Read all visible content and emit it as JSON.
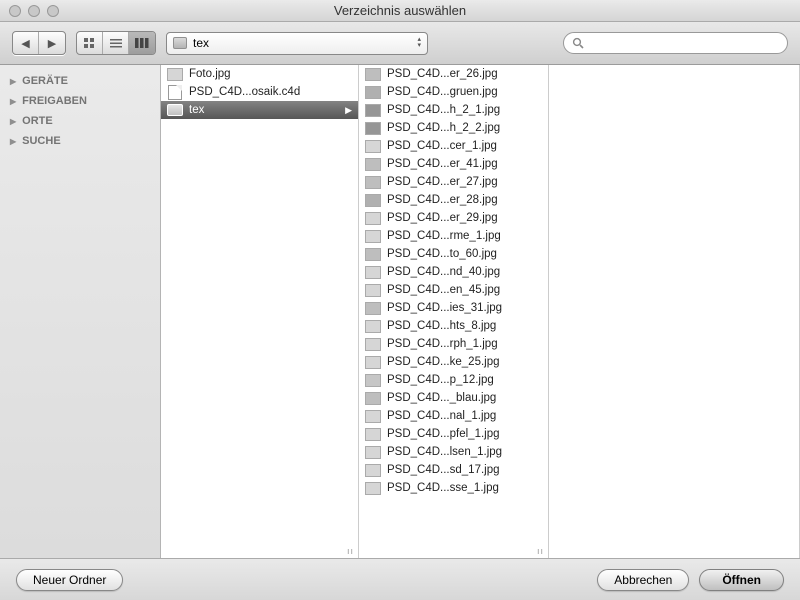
{
  "window": {
    "title": "Verzeichnis auswählen"
  },
  "path": {
    "current": "tex"
  },
  "search": {
    "placeholder": ""
  },
  "sidebar": {
    "sections": [
      {
        "label": "GERÄTE"
      },
      {
        "label": "FREIGABEN"
      },
      {
        "label": "ORTE"
      },
      {
        "label": "SUCHE"
      }
    ]
  },
  "columns": {
    "c1": [
      {
        "kind": "img",
        "name": "Foto.jpg"
      },
      {
        "kind": "doc",
        "name": "PSD_C4D...osaik.c4d"
      },
      {
        "kind": "folder",
        "name": "tex",
        "selected": true
      }
    ],
    "c2": [
      {
        "t": "b",
        "name": "PSD_C4D...er_26.jpg"
      },
      {
        "t": "g",
        "name": "PSD_C4D...gruen.jpg"
      },
      {
        "t": "r",
        "name": "PSD_C4D...h_2_1.jpg"
      },
      {
        "t": "r",
        "name": "PSD_C4D...h_2_2.jpg"
      },
      {
        "t": "",
        "name": "PSD_C4D...cer_1.jpg"
      },
      {
        "t": "b",
        "name": "PSD_C4D...er_41.jpg"
      },
      {
        "t": "b",
        "name": "PSD_C4D...er_27.jpg"
      },
      {
        "t": "g",
        "name": "PSD_C4D...er_28.jpg"
      },
      {
        "t": "",
        "name": "PSD_C4D...er_29.jpg"
      },
      {
        "t": "",
        "name": "PSD_C4D...rme_1.jpg"
      },
      {
        "t": "b",
        "name": "PSD_C4D...to_60.jpg"
      },
      {
        "t": "",
        "name": "PSD_C4D...nd_40.jpg"
      },
      {
        "t": "",
        "name": "PSD_C4D...en_45.jpg"
      },
      {
        "t": "b",
        "name": "PSD_C4D...ies_31.jpg"
      },
      {
        "t": "",
        "name": "PSD_C4D...hts_8.jpg"
      },
      {
        "t": "",
        "name": "PSD_C4D...rph_1.jpg"
      },
      {
        "t": "",
        "name": "PSD_C4D...ke_25.jpg"
      },
      {
        "t": "y",
        "name": "PSD_C4D...p_12.jpg"
      },
      {
        "t": "b",
        "name": "PSD_C4D..._blau.jpg"
      },
      {
        "t": "",
        "name": "PSD_C4D...nal_1.jpg"
      },
      {
        "t": "",
        "name": "PSD_C4D...pfel_1.jpg"
      },
      {
        "t": "",
        "name": "PSD_C4D...lsen_1.jpg"
      },
      {
        "t": "",
        "name": "PSD_C4D...sd_17.jpg"
      },
      {
        "t": "",
        "name": "PSD_C4D...sse_1.jpg"
      }
    ]
  },
  "footer": {
    "new_folder": "Neuer Ordner",
    "cancel": "Abbrechen",
    "open": "Öffnen"
  }
}
